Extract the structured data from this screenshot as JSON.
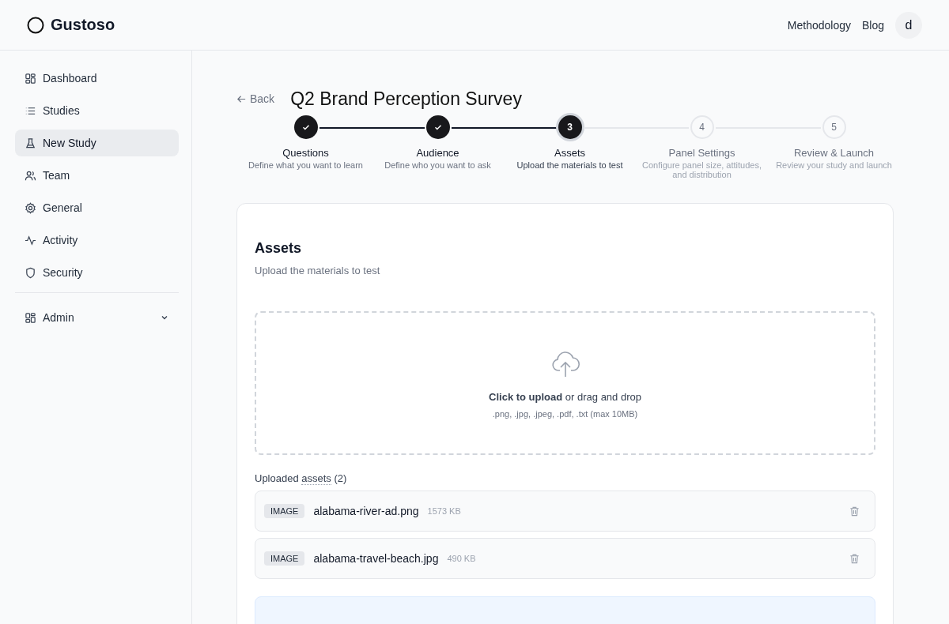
{
  "brand": {
    "name": "Gustoso"
  },
  "top_nav": [
    {
      "label": "Methodology"
    },
    {
      "label": "Blog"
    }
  ],
  "avatar": {
    "initial": "d"
  },
  "sidebar": {
    "items": [
      {
        "label": "Dashboard",
        "selected": false
      },
      {
        "label": "Studies",
        "selected": false
      },
      {
        "label": "New Study",
        "selected": true
      },
      {
        "label": "Team",
        "selected": false
      },
      {
        "label": "General",
        "selected": false
      },
      {
        "label": "Activity",
        "selected": false
      },
      {
        "label": "Security",
        "selected": false
      }
    ],
    "admin": {
      "label": "Admin",
      "expanded": false
    }
  },
  "back": {
    "label": "Back"
  },
  "title": "Q2 Brand Perception Survey",
  "steps": [
    {
      "title": "Questions",
      "subtitle": "Define what you want to learn",
      "kind": "done"
    },
    {
      "title": "Audience",
      "subtitle": "Define who you want to ask",
      "kind": "done"
    },
    {
      "number": "3",
      "title": "Assets",
      "subtitle": "Upload the materials to test",
      "kind": "current"
    },
    {
      "number": "4",
      "title": "Panel Settings",
      "subtitle": "Configure panel size, attitudes, and distribution",
      "kind": "upcoming"
    },
    {
      "number": "5",
      "title": "Review & Launch",
      "subtitle": "Review your study and launch",
      "kind": "upcoming"
    }
  ],
  "card": {
    "title": "Assets",
    "subtitle": "Upload the materials to test",
    "dropzone": {
      "text": "**Click to upload** or drag and drop",
      "hint": ".png, .jpg, .jpeg, .pdf, .txt (max 10MB)"
    },
    "uploaded": {
      "label": "Uploaded",
      "term": "assets",
      "count": "(2)"
    },
    "files": [
      {
        "type": "IMAGE",
        "name": "alabama-river-ad.png",
        "size": "1573 KB"
      },
      {
        "type": "IMAGE",
        "name": "alabama-travel-beach.jpg",
        "size": "490 KB"
      }
    ]
  }
}
